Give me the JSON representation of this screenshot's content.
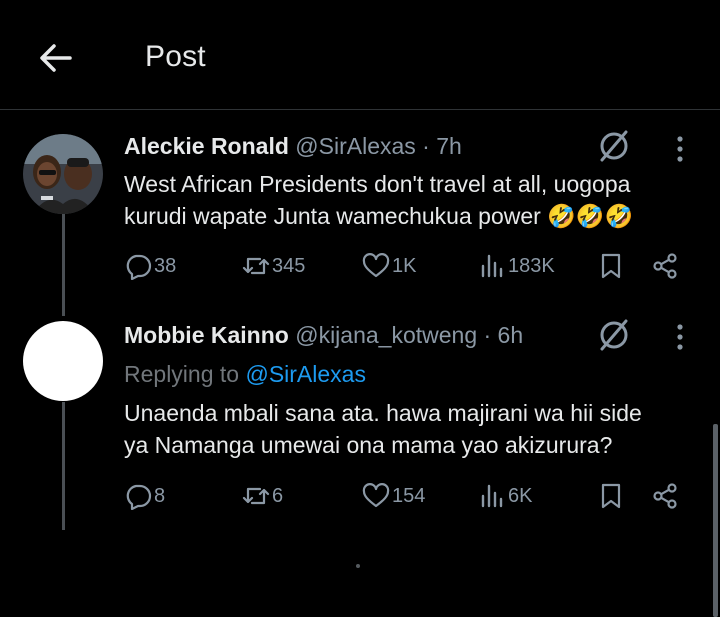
{
  "header": {
    "title": "Post",
    "back_icon": "arrow-left-icon"
  },
  "tweets": [
    {
      "name": "Aleckie Ronald",
      "handle_time": "@SirAlexas · 7h",
      "text_line1": "West African Presidents don't travel at all, uogopa",
      "text_line2": "kurudi wapate Junta wamechukua power 🤣🤣🤣",
      "replies": "38",
      "reposts": "345",
      "likes": "1K",
      "views": "183K"
    },
    {
      "name": "Mobbie Kainno",
      "handle_time": "@kijana_kotweng · 6h",
      "replying_prefix": "Replying to ",
      "replying_handle": "@SirAlexas",
      "text_line1": "Unaenda mbali sana ata. hawa majirani wa hii side",
      "text_line2": "ya Namanga umewai ona mama yao akizurura?",
      "replies": "8",
      "reposts": "6",
      "likes": "154",
      "views": "6K"
    }
  ],
  "colors": {
    "background": "#000000",
    "text": "#e7e9ea",
    "muted": "#8b98a5",
    "link": "#1d9bf0"
  }
}
